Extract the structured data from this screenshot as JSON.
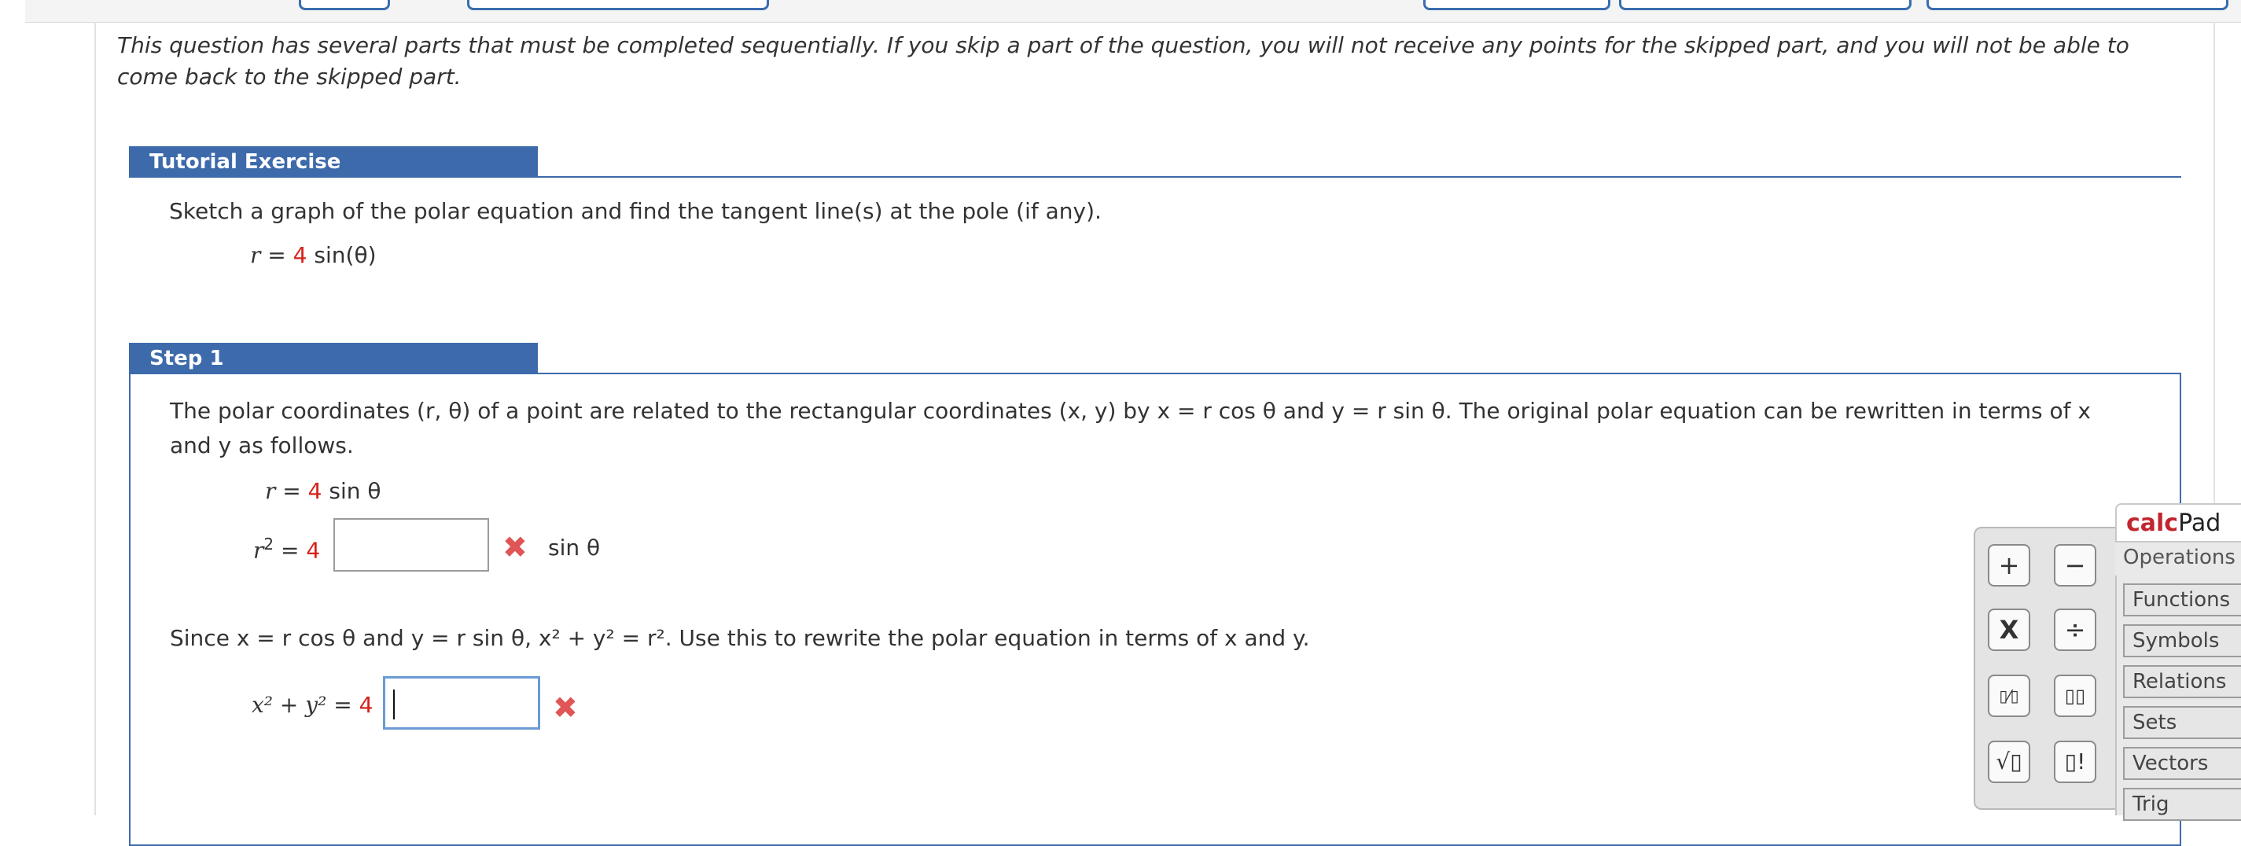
{
  "intro_text": "This question has several parts that must be completed sequentially. If you skip a part of the question, you will not receive any points for the skipped part, and you will not be able to come back to the skipped part.",
  "tutorial": {
    "header": "Tutorial Exercise",
    "prompt": "Sketch a graph of the polar equation and find the tangent line(s) at the pole (if any).",
    "equation": {
      "lhs": "r",
      "eq": "=",
      "coef": "4",
      "rest": "sin(θ)"
    }
  },
  "step1": {
    "header": "Step 1",
    "text": "The polar coordinates (r, θ) of a point are related to the rectangular coordinates (x, y) by x = r cos θ and y = r sin θ. The original polar equation can be rewritten in terms of x and y as follows.",
    "line1": {
      "lhs": "r",
      "eq": "=",
      "coef": "4",
      "rest": "sin θ"
    },
    "line2": {
      "lhs": "r",
      "exp": "2",
      "eq": "=",
      "coef": "4",
      "answer": "",
      "after": "sin θ"
    },
    "since_text": "Since x = r cos θ and y = r sin θ, x² + y² = r². Use this to rewrite the polar equation in terms of x and y.",
    "line3": {
      "lhs": "x² + y²",
      "eq": "=",
      "coef": "4",
      "answer": ""
    }
  },
  "calcpad": {
    "title_red": "calc",
    "title_black": "Pad",
    "tabs": [
      "Operations",
      "Functions",
      "Symbols",
      "Relations",
      "Sets",
      "Vectors",
      "Trig"
    ],
    "buttons": {
      "plus": "+",
      "minus": "−",
      "times": "X",
      "divide": "÷",
      "fraction": "▯⁄▯",
      "power": "▯▯",
      "sqrt": "√▯",
      "factorial": "▯!"
    }
  },
  "colors": {
    "header_blue": "#3d6aaa",
    "red_coef": "#d6231c",
    "x_mark": "#e05555"
  }
}
